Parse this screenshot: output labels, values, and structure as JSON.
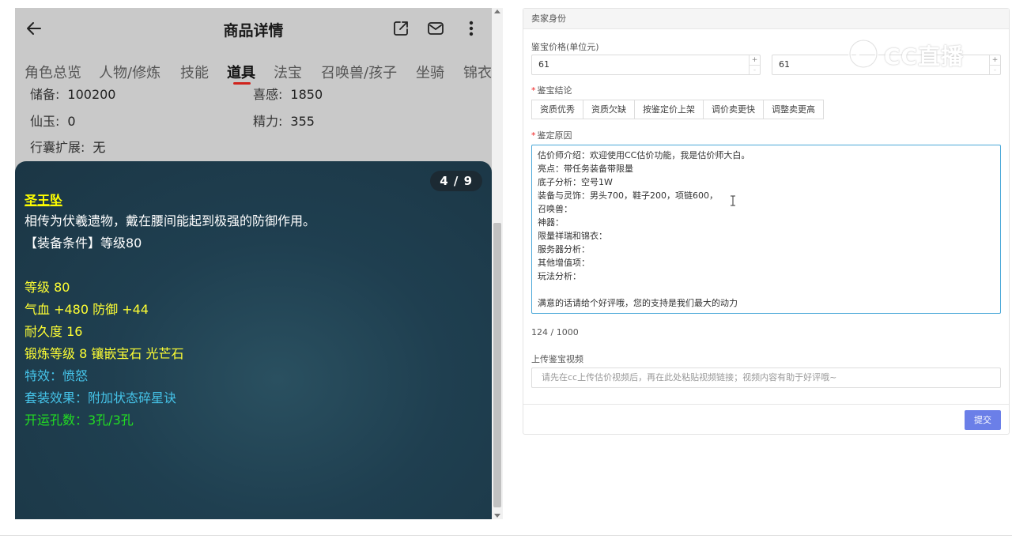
{
  "mobile": {
    "title": "商品详情",
    "tabs": [
      {
        "label": "角色总览"
      },
      {
        "label": "人物/修炼"
      },
      {
        "label": "技能"
      },
      {
        "label": "道具"
      },
      {
        "label": "法宝"
      },
      {
        "label": "召唤兽/孩子"
      },
      {
        "label": "坐骑"
      },
      {
        "label": "锦衣"
      }
    ],
    "active_tab": "道具",
    "stats": [
      {
        "label": "储备:",
        "value": "100200"
      },
      {
        "label": "喜感:",
        "value": "1850"
      },
      {
        "label": "仙玉:",
        "value": "0"
      },
      {
        "label": "精力:",
        "value": "355"
      },
      {
        "label": "行囊扩展:",
        "value": "无"
      }
    ],
    "item": {
      "page": "4 / 9",
      "name": "圣王坠",
      "desc": "相传为伏羲遗物，戴在腰间能起到极强的防御作用。",
      "condition": "【装备条件】等级80",
      "level": "等级 80",
      "hp_def": "气血 +480 防御 +44",
      "durability": "耐久度 16",
      "forge": "锻炼等级 8 镶嵌宝石 光芒石",
      "special": "特效：愤怒",
      "set": "套装效果：附加状态碎星诀",
      "holes": "开运孔数：3孔/3孔"
    }
  },
  "form": {
    "header": "卖家身份",
    "price_label": "鉴宝价格(单位元)",
    "price_min": "61",
    "price_max": "61",
    "verdict_label": "鉴宝结论",
    "verdict_buttons": [
      "资质优秀",
      "资质欠缺",
      "按鉴定价上架",
      "调价卖更快",
      "调整卖更高"
    ],
    "reason_label": "鉴定原因",
    "reason_lines": [
      "估价师介绍：欢迎使用CC估价功能，我是估价师大白。",
      "亮点：带任务装备带限量",
      "底子分析：空号1W",
      "装备与灵饰：男头700，鞋子200，项链600，",
      "召唤兽：",
      "神器：",
      "限量祥瑞和锦衣：",
      "服务器分析：",
      "其他增值项：",
      "玩法分析：",
      "",
      "满意的话请给个好评哦，您的支持是我们最大的动力"
    ],
    "char_count": "124 / 1000",
    "video_label": "上传鉴宝视频",
    "video_placeholder": "请先在cc上传估价视频后，再在此处粘贴视频链接；视频内容有助于好评哦~",
    "submit": "提交",
    "spin_up": "+",
    "spin_down": "-"
  },
  "watermark": "CC直播",
  "icons": [
    "back-arrow-icon",
    "share-icon",
    "mail-icon",
    "more-icon",
    "text-cursor-icon"
  ]
}
